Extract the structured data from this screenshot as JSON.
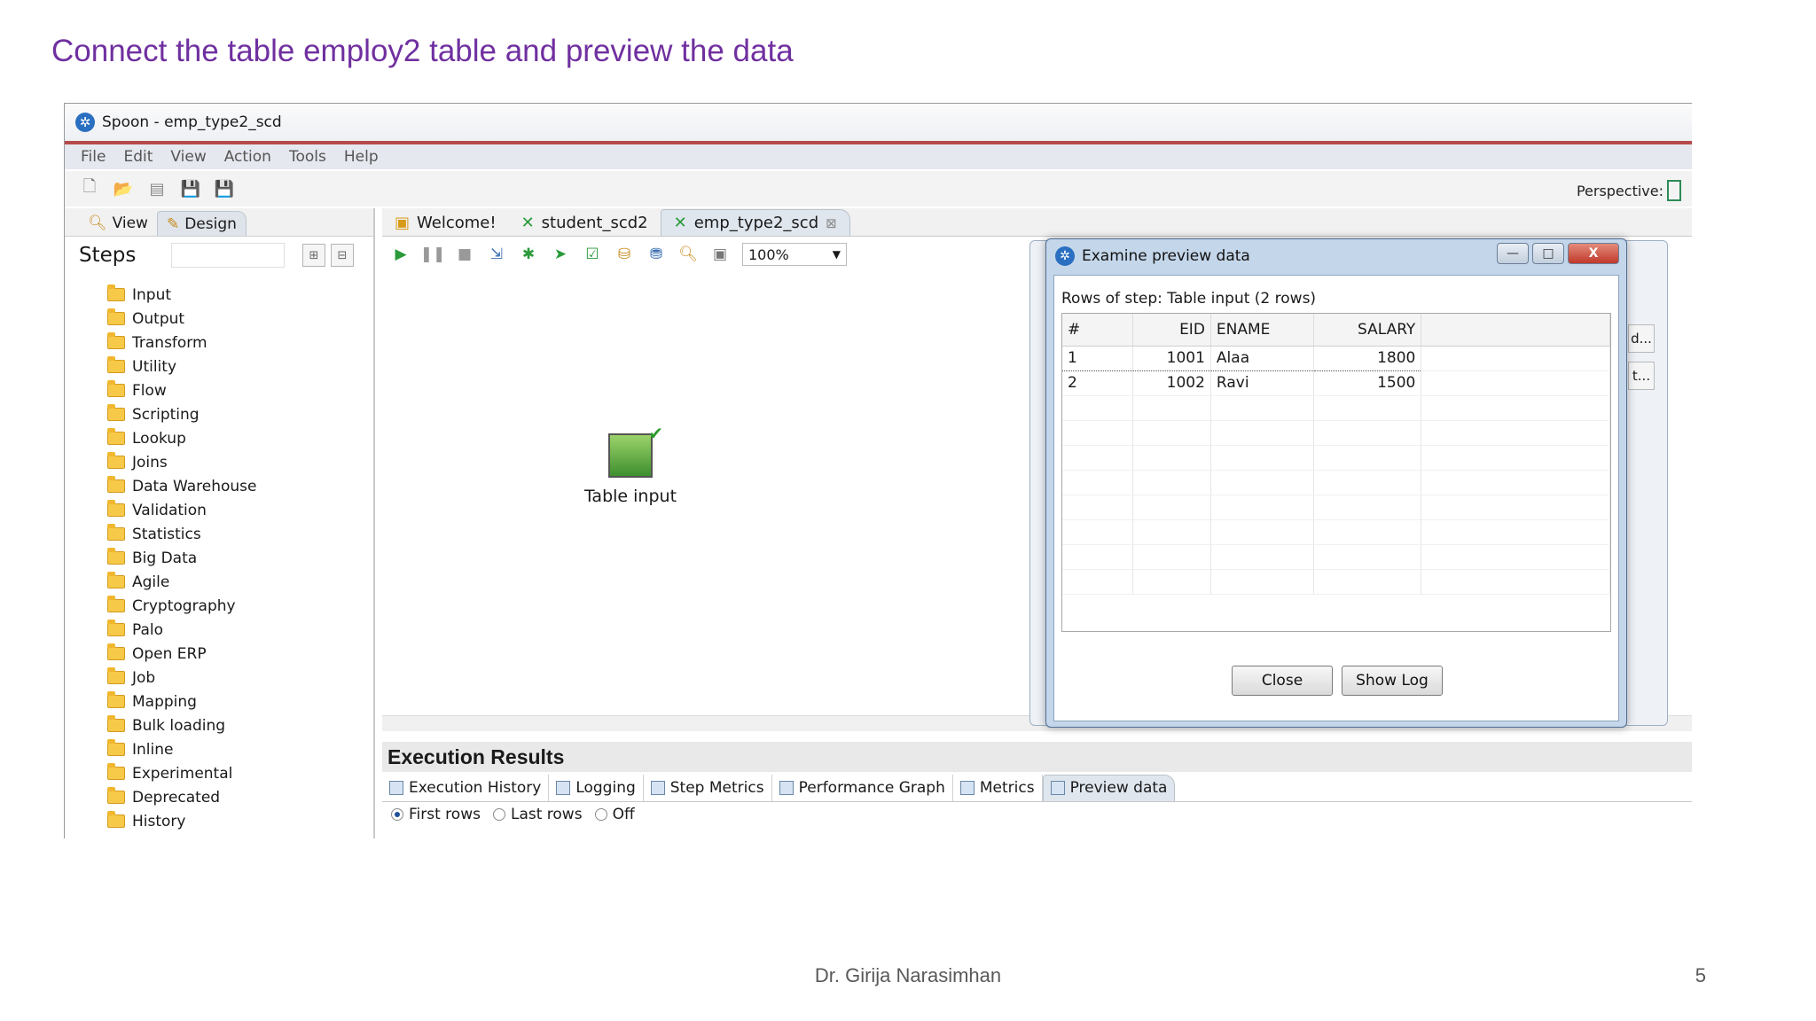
{
  "slide": {
    "title": "Connect the table employ2 table and preview the data",
    "author": "Dr. Girija Narasimhan",
    "page": "5"
  },
  "window": {
    "title": "Spoon - emp_type2_scd",
    "menu": [
      "File",
      "Edit",
      "View",
      "Action",
      "Tools",
      "Help"
    ],
    "perspective_label": "Perspective:"
  },
  "left_panel": {
    "tabs": [
      "View",
      "Design"
    ],
    "steps_label": "Steps",
    "folders": [
      "Input",
      "Output",
      "Transform",
      "Utility",
      "Flow",
      "Scripting",
      "Lookup",
      "Joins",
      "Data Warehouse",
      "Validation",
      "Statistics",
      "Big Data",
      "Agile",
      "Cryptography",
      "Palo",
      "Open ERP",
      "Job",
      "Mapping",
      "Bulk loading",
      "Inline",
      "Experimental",
      "Deprecated",
      "History"
    ]
  },
  "doc_tabs": [
    "Welcome!",
    "student_scd2",
    "emp_type2_scd"
  ],
  "canvas": {
    "zoom": "100%",
    "step_label": "Table input"
  },
  "execution": {
    "header": "Execution Results",
    "tabs": [
      "Execution History",
      "Logging",
      "Step Metrics",
      "Performance Graph",
      "Metrics",
      "Preview data"
    ],
    "radios": [
      "First rows",
      "Last rows",
      "Off"
    ],
    "selected_radio": "First rows"
  },
  "background_dialog": {
    "button_labels": [
      "d...",
      "t..."
    ]
  },
  "dialog": {
    "title": "Examine preview data",
    "rows_label": "Rows of step: Table input (2 rows)",
    "columns": [
      "#",
      "EID",
      "ENAME",
      "SALARY"
    ],
    "rows": [
      [
        "1",
        "1001",
        "Alaa",
        "1800"
      ],
      [
        "2",
        "1002",
        "Ravi",
        "1500"
      ]
    ],
    "buttons": {
      "close": "Close",
      "show_log": "Show Log"
    },
    "window_controls": [
      "—",
      "□",
      "X"
    ]
  },
  "colors": {
    "title_purple": "#7030a0",
    "accent_green": "#2a9a3a",
    "dialog_frame": "#c4d6ea"
  }
}
